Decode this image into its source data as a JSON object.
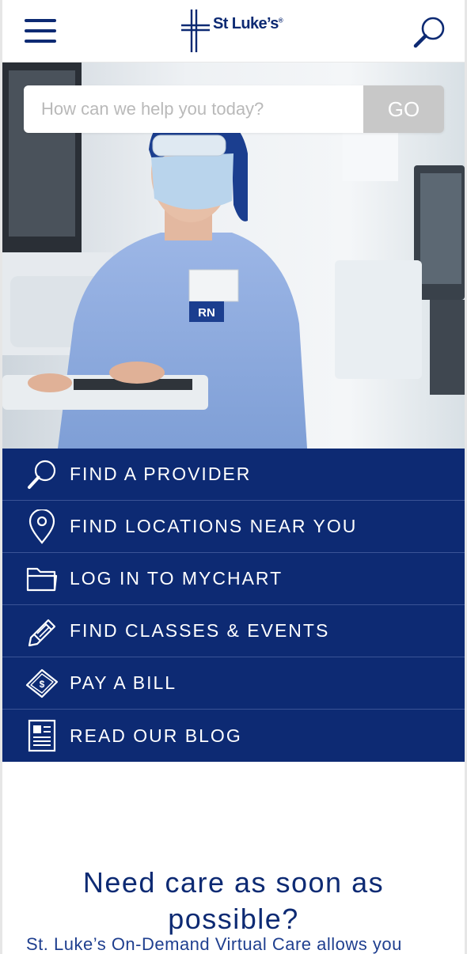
{
  "header": {
    "menu_icon": "hamburger-menu-icon",
    "logo_text": "St Luke’s",
    "logo_mark": "®",
    "search_icon": "magnifier-icon"
  },
  "hero": {
    "search_placeholder": "How can we help you today?",
    "go_label": "GO",
    "photo_badge": "RN"
  },
  "quick_links": [
    {
      "label": "FIND A PROVIDER",
      "icon": "magnifier-icon"
    },
    {
      "label": "FIND LOCATIONS NEAR YOU",
      "icon": "map-pin-icon"
    },
    {
      "label": "LOG IN TO MYCHART",
      "icon": "folder-icon"
    },
    {
      "label": "FIND CLASSES & EVENTS",
      "icon": "pencil-icon"
    },
    {
      "label": "PAY A BILL",
      "icon": "money-bill-icon"
    },
    {
      "label": "READ OUR BLOG",
      "icon": "newspaper-icon"
    }
  ],
  "promo": {
    "title": "Need care as soon as possible?",
    "body": "St. Luke’s On-Demand Virtual Care allows you"
  },
  "colors": {
    "brand_navy": "#0d2a73",
    "go_button": "#c8c8c8",
    "white": "#ffffff"
  }
}
